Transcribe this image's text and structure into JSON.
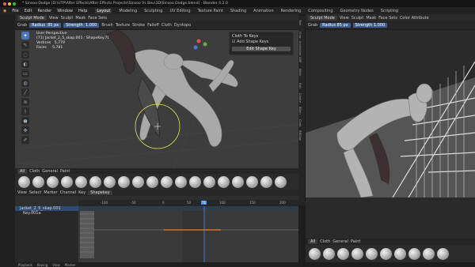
{
  "window": {
    "title": "* Sinsoo Dodge [D:\\UTP\\After Effects\\After Effects Projects\\Sinsoo Vs Beu\\3D\\Sinsoo Dodge.blend] - Blender 4.2.0"
  },
  "menu": {
    "items": [
      "File",
      "Edit",
      "Render",
      "Window",
      "Help"
    ],
    "workspaces": [
      "Layout",
      "Modeling",
      "Sculpting",
      "UV Editing",
      "Texture Paint",
      "Shading",
      "Animation",
      "Rendering",
      "Compositing",
      "Geometry Nodes",
      "Scripting"
    ],
    "active_workspace": "Layout"
  },
  "main_header": {
    "mode": "Sculpt Mode",
    "menus": [
      "View",
      "Sculpt",
      "Mask",
      "Face Sets"
    ],
    "tool": "Grab",
    "radius_label": "Radius",
    "radius_value": "85 px",
    "strength_label": "Strength",
    "strength_value": "1.000",
    "items": [
      "Brush",
      "Texture",
      "Stroke",
      "Falloff",
      "Cloth"
    ],
    "symmetry": "Dyntopo"
  },
  "viewport": {
    "view_name": "User Perspective",
    "object_line": "(71) Jacket_2_5_skap.001 : ShapeKey.71",
    "vertices_label": "Vertices",
    "vertices_value": "5,779",
    "faces_label": "Faces",
    "faces_value": "5,781"
  },
  "shape_panel": {
    "title": "Cloth To Keys",
    "checkbox_label": "Add Shape Keys",
    "button_label": "Edit Shape Key"
  },
  "side_tabs": [
    "Tool",
    "View",
    "Animation",
    "ARP",
    "Mesh",
    "Edit",
    "Create",
    "BGen",
    "Cloth",
    "RBDlab"
  ],
  "right_header": {
    "mode": "Sculpt Mode",
    "menus": [
      "View",
      "Sculpt",
      "Mask",
      "Face Sets"
    ],
    "tool": "Grab",
    "radius_label": "Radius",
    "radius_value": "85 px",
    "strength_label": "Strength",
    "strength_value": "1.000",
    "extra": "Color Attribute"
  },
  "brush_tabs": [
    "All",
    "Cloth",
    "General",
    "Paint"
  ],
  "dopesheet": {
    "menus": [
      "View",
      "Select",
      "Marker",
      "Channel",
      "Key"
    ],
    "mode": "Shapekey",
    "channels": [
      "Jacket_2_5_skap.001",
      "Key.001a"
    ],
    "ticks": [
      "-100",
      "-50",
      "0",
      "50",
      "71",
      "100",
      "150",
      "200"
    ],
    "current_frame": "71"
  },
  "status": {
    "items": [
      "Playback",
      "Keying",
      "View",
      "Marker"
    ]
  },
  "colors": {
    "accent": "#4a74b8",
    "playhead": "#4a8cff",
    "keyline": "#d0722e",
    "viewport_bg": "#3d3d3d"
  }
}
